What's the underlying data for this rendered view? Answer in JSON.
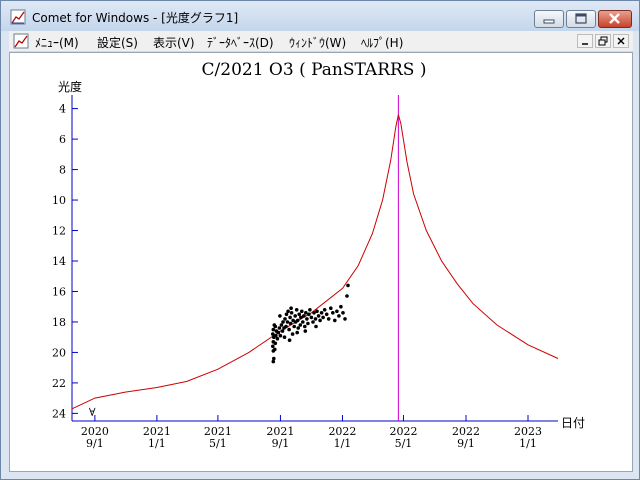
{
  "window": {
    "title": "Comet for Windows - [光度グラフ1]",
    "close_color": "#c8432b"
  },
  "menubar": {
    "items": [
      {
        "label": "ﾒﾆｭｰ(M)"
      },
      {
        "label": "設定(S)"
      },
      {
        "label": "表示(V)"
      },
      {
        "label": "ﾃﾞｰﾀﾍﾞｰｽ(D)"
      },
      {
        "label": "ｳｨﾝﾄﾞｳ(W)"
      },
      {
        "label": "ﾍﾙﾌﾟ(H)"
      }
    ]
  },
  "icons": {
    "app": "graph-document-icon",
    "minimize": "minimize-icon",
    "maximize": "maximize-icon",
    "close": "close-icon",
    "child_minimize": "child-minimize-icon",
    "child_restore": "child-restore-icon",
    "child_close": "child-close-icon"
  },
  "chart_data": {
    "type": "line",
    "title": "C/2021 O3 ( PanSTARRS )",
    "ylabel": "光度",
    "xlabel": "日付",
    "y_inverted": true,
    "ylim": [
      24.5,
      3.5
    ],
    "y_ticks": [
      4,
      6,
      8,
      10,
      12,
      14,
      16,
      18,
      20,
      22,
      24
    ],
    "x_range": [
      "2020-07-18",
      "2023-03-01"
    ],
    "x_ticks": [
      {
        "date": "2020-09-01",
        "year": "2020",
        "md": "9/1"
      },
      {
        "date": "2021-01-01",
        "year": "2021",
        "md": "1/1"
      },
      {
        "date": "2021-05-01",
        "year": "2021",
        "md": "5/1"
      },
      {
        "date": "2021-09-01",
        "year": "2021",
        "md": "9/1"
      },
      {
        "date": "2022-01-01",
        "year": "2022",
        "md": "1/1"
      },
      {
        "date": "2022-05-01",
        "year": "2022",
        "md": "5/1"
      },
      {
        "date": "2022-09-01",
        "year": "2022",
        "md": "9/1"
      },
      {
        "date": "2023-01-01",
        "year": "2023",
        "md": "1/1"
      }
    ],
    "perihelion_date": "2022-04-21",
    "marker": {
      "date": "2020-09-01",
      "mag": 23.9,
      "label": "∀"
    },
    "colors": {
      "axis": "#0000cc",
      "curve": "#cc0000",
      "perihelion": "#cc00cc",
      "points": "#000000"
    },
    "series": [
      {
        "kind": "predicted",
        "points": [
          {
            "date": "2020-07-18",
            "mag": 23.7
          },
          {
            "date": "2020-09-01",
            "mag": 23.0
          },
          {
            "date": "2020-11-01",
            "mag": 22.6
          },
          {
            "date": "2021-01-01",
            "mag": 22.3
          },
          {
            "date": "2021-03-01",
            "mag": 21.9
          },
          {
            "date": "2021-05-01",
            "mag": 21.1
          },
          {
            "date": "2021-07-01",
            "mag": 20.0
          },
          {
            "date": "2021-09-01",
            "mag": 18.6
          },
          {
            "date": "2021-11-01",
            "mag": 17.4
          },
          {
            "date": "2022-01-01",
            "mag": 15.8
          },
          {
            "date": "2022-02-01",
            "mag": 14.3
          },
          {
            "date": "2022-03-01",
            "mag": 12.2
          },
          {
            "date": "2022-03-21",
            "mag": 10.0
          },
          {
            "date": "2022-04-06",
            "mag": 7.4
          },
          {
            "date": "2022-04-16",
            "mag": 5.2
          },
          {
            "date": "2022-04-21",
            "mag": 4.4
          },
          {
            "date": "2022-04-26",
            "mag": 5.0
          },
          {
            "date": "2022-05-08",
            "mag": 7.5
          },
          {
            "date": "2022-05-21",
            "mag": 9.6
          },
          {
            "date": "2022-06-15",
            "mag": 12.0
          },
          {
            "date": "2022-07-15",
            "mag": 14.0
          },
          {
            "date": "2022-08-15",
            "mag": 15.5
          },
          {
            "date": "2022-09-15",
            "mag": 16.8
          },
          {
            "date": "2022-11-01",
            "mag": 18.2
          },
          {
            "date": "2023-01-01",
            "mag": 19.5
          },
          {
            "date": "2023-03-01",
            "mag": 20.4
          }
        ]
      },
      {
        "kind": "observed",
        "points": [
          {
            "date": "2021-08-18",
            "mag": 20.6
          },
          {
            "date": "2021-08-19",
            "mag": 20.4
          },
          {
            "date": "2021-08-18",
            "mag": 19.9
          },
          {
            "date": "2021-08-17",
            "mag": 19.6
          },
          {
            "date": "2021-08-18",
            "mag": 19.3
          },
          {
            "date": "2021-08-19",
            "mag": 19.0
          },
          {
            "date": "2021-08-17",
            "mag": 18.8
          },
          {
            "date": "2021-08-18",
            "mag": 18.5
          },
          {
            "date": "2021-08-20",
            "mag": 18.2
          },
          {
            "date": "2021-08-21",
            "mag": 19.8
          },
          {
            "date": "2021-08-22",
            "mag": 19.4
          },
          {
            "date": "2021-08-23",
            "mag": 18.9
          },
          {
            "date": "2021-08-24",
            "mag": 18.6
          },
          {
            "date": "2021-08-22",
            "mag": 18.3
          },
          {
            "date": "2021-08-26",
            "mag": 19.1
          },
          {
            "date": "2021-08-28",
            "mag": 18.7
          },
          {
            "date": "2021-08-30",
            "mag": 18.4
          },
          {
            "date": "2021-09-01",
            "mag": 18.9
          },
          {
            "date": "2021-09-03",
            "mag": 18.2
          },
          {
            "date": "2021-09-05",
            "mag": 18.6
          },
          {
            "date": "2021-09-06",
            "mag": 18.0
          },
          {
            "date": "2021-09-08",
            "mag": 18.4
          },
          {
            "date": "2021-09-10",
            "mag": 17.8
          },
          {
            "date": "2021-09-12",
            "mag": 18.3
          },
          {
            "date": "2021-09-13",
            "mag": 17.5
          },
          {
            "date": "2021-09-15",
            "mag": 18.0
          },
          {
            "date": "2021-09-16",
            "mag": 17.3
          },
          {
            "date": "2021-09-18",
            "mag": 18.5
          },
          {
            "date": "2021-09-20",
            "mag": 17.7
          },
          {
            "date": "2021-09-21",
            "mag": 18.1
          },
          {
            "date": "2021-09-23",
            "mag": 17.4
          },
          {
            "date": "2021-09-25",
            "mag": 18.8
          },
          {
            "date": "2021-09-26",
            "mag": 17.9
          },
          {
            "date": "2021-09-28",
            "mag": 18.3
          },
          {
            "date": "2021-09-30",
            "mag": 17.6
          },
          {
            "date": "2021-10-01",
            "mag": 18.0
          },
          {
            "date": "2021-10-03",
            "mag": 17.2
          },
          {
            "date": "2021-10-05",
            "mag": 17.9
          },
          {
            "date": "2021-10-06",
            "mag": 18.4
          },
          {
            "date": "2021-10-08",
            "mag": 17.5
          },
          {
            "date": "2021-10-10",
            "mag": 18.2
          },
          {
            "date": "2021-10-11",
            "mag": 17.7
          },
          {
            "date": "2021-10-13",
            "mag": 17.3
          },
          {
            "date": "2021-10-15",
            "mag": 18.0
          },
          {
            "date": "2021-10-17",
            "mag": 17.6
          },
          {
            "date": "2021-10-19",
            "mag": 18.3
          },
          {
            "date": "2021-10-21",
            "mag": 17.4
          },
          {
            "date": "2021-10-23",
            "mag": 17.8
          },
          {
            "date": "2021-10-25",
            "mag": 18.1
          },
          {
            "date": "2021-10-27",
            "mag": 17.5
          },
          {
            "date": "2021-10-29",
            "mag": 17.2
          },
          {
            "date": "2021-11-01",
            "mag": 17.7
          },
          {
            "date": "2021-11-04",
            "mag": 18.0
          },
          {
            "date": "2021-11-06",
            "mag": 17.4
          },
          {
            "date": "2021-11-09",
            "mag": 17.8
          },
          {
            "date": "2021-11-12",
            "mag": 17.3
          },
          {
            "date": "2021-11-15",
            "mag": 17.6
          },
          {
            "date": "2021-11-18",
            "mag": 17.9
          },
          {
            "date": "2021-11-21",
            "mag": 17.4
          },
          {
            "date": "2021-11-24",
            "mag": 17.7
          },
          {
            "date": "2021-11-27",
            "mag": 17.2
          },
          {
            "date": "2021-12-01",
            "mag": 17.5
          },
          {
            "date": "2021-12-05",
            "mag": 17.8
          },
          {
            "date": "2021-12-09",
            "mag": 17.1
          },
          {
            "date": "2021-12-13",
            "mag": 17.4
          },
          {
            "date": "2021-12-17",
            "mag": 17.9
          },
          {
            "date": "2021-12-21",
            "mag": 17.3
          },
          {
            "date": "2021-12-25",
            "mag": 17.6
          },
          {
            "date": "2021-12-29",
            "mag": 17.0
          },
          {
            "date": "2022-01-02",
            "mag": 17.4
          },
          {
            "date": "2022-01-06",
            "mag": 17.8
          },
          {
            "date": "2022-01-10",
            "mag": 16.3
          },
          {
            "date": "2022-01-12",
            "mag": 15.6
          },
          {
            "date": "2021-09-09",
            "mag": 19.0
          },
          {
            "date": "2021-09-19",
            "mag": 19.2
          },
          {
            "date": "2021-10-04",
            "mag": 18.7
          },
          {
            "date": "2021-10-20",
            "mag": 18.6
          },
          {
            "date": "2021-11-10",
            "mag": 18.3
          },
          {
            "date": "2021-08-31",
            "mag": 17.6
          },
          {
            "date": "2021-09-22",
            "mag": 17.1
          }
        ]
      }
    ]
  }
}
